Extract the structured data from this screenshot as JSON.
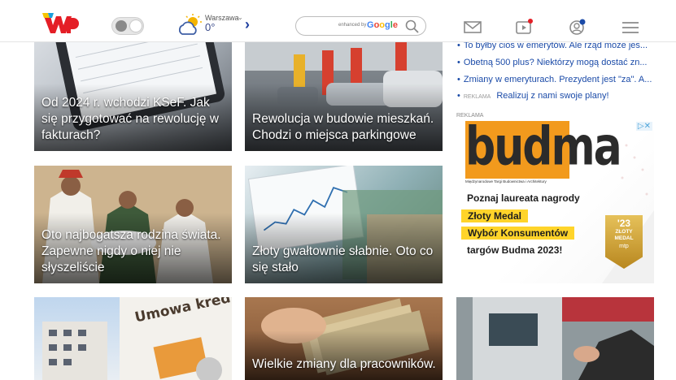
{
  "header": {
    "weather_city": "Warszawa",
    "weather_temp": "0°",
    "search_powered": "enhanced by",
    "search_brand": "Google"
  },
  "articles": [
    {
      "caption": "Od 2024 r. wchodzi KSeF. Jak się przygotować na rewolucję w fakturach?"
    },
    {
      "caption": "Rewolucja w budowie mieszkań. Chodzi o miejsca parkingowe"
    },
    {
      "caption": "Oto najbogatsza rodzina świata. Zapewne nigdy o niej nie słyszeliście"
    },
    {
      "caption": "Złoty gwałtownie słabnie. Oto co się stało"
    },
    {
      "caption": "Umowa kredy",
      "image_text": "Umowa kredy"
    },
    {
      "caption": "Wielkie zmiany dla pracowników."
    },
    {
      "caption": ""
    }
  ],
  "news_list": [
    "To byłby cios w emerytów. Ale rząd może jes...",
    "Obetną 500 plus? Niektórzy mogą dostać zn...",
    "Zmiany w emeryturach. Prezydent jest \"za\". A..."
  ],
  "sponsored": {
    "tag": "REKLAMA",
    "text": "Realizuj z nami swoje plany!"
  },
  "ad": {
    "label": "REKLAMA",
    "brand": "budma",
    "subtitle": "Międzynarodowe Targi Budownictwa i Architektury",
    "line1": "Poznaj laureata nagrody",
    "line2": "Złoty Medal",
    "line3": "Wybór Konsumentów",
    "line4": "targów Budma 2023!",
    "badge_year": "'23",
    "badge_title": "ZŁOTY MEDAL",
    "badge_brand": "mtp"
  },
  "colors": {
    "accent": "#1b4ba8",
    "ad_orange": "#f29a1d",
    "ad_yellow": "#ffd42a"
  }
}
